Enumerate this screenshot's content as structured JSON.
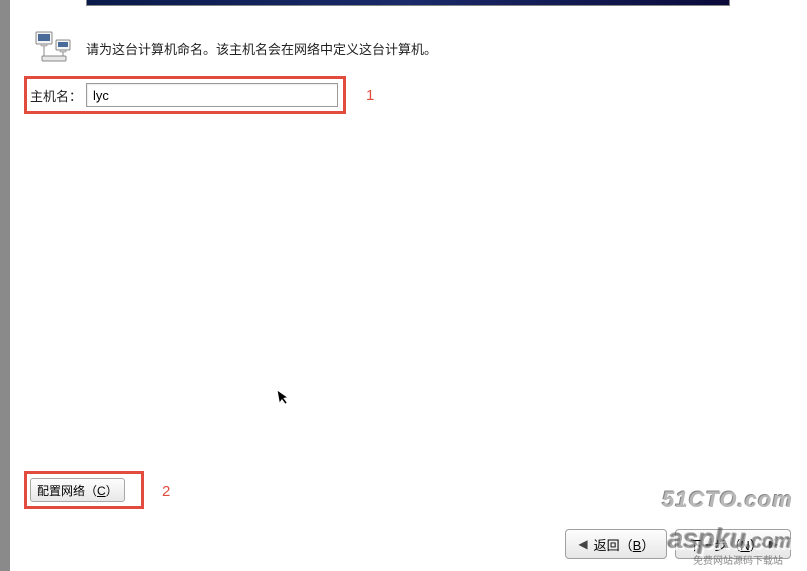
{
  "banner": {},
  "instruction": {
    "text": "请为这台计算机命名。该主机名会在网络中定义这台计算机。"
  },
  "hostname": {
    "label": "主机名：",
    "value": "lyc"
  },
  "annotations": {
    "one": "1",
    "two": "2"
  },
  "buttons": {
    "config_network_prefix": "配置网络（",
    "config_network_underline": "C",
    "config_network_suffix": "）",
    "back_prefix": "返回（",
    "back_underline": "B",
    "back_suffix": "）",
    "next_prefix": "下一步（",
    "next_underline": "N",
    "next_suffix": "）"
  },
  "watermarks": {
    "w1": "51CTO.com",
    "w2": "aspku",
    "w2_suffix": ".com",
    "w2_sub": "免费网站源码下载站"
  }
}
